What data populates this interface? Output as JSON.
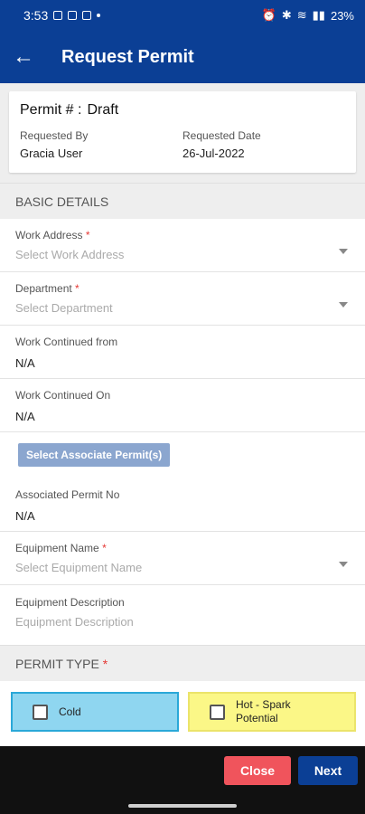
{
  "status_bar": {
    "time": "3:53",
    "battery": "23%"
  },
  "app_bar": {
    "title": "Request Permit"
  },
  "summary": {
    "permit_label": "Permit # :",
    "permit_value": "Draft",
    "requested_by_label": "Requested By",
    "requested_by_value": "Gracia User",
    "requested_date_label": "Requested Date",
    "requested_date_value": "26-Jul-2022"
  },
  "basic_details": {
    "header": "BASIC DETAILS",
    "work_address": {
      "label": "Work Address",
      "placeholder": "Select Work Address"
    },
    "department": {
      "label": "Department",
      "placeholder": "Select Department"
    },
    "work_continued_from": {
      "label": "Work Continued from",
      "value": "N/A"
    },
    "work_continued_on": {
      "label": "Work Continued On",
      "value": "N/A"
    },
    "select_associate_button": "Select Associate Permit(s)",
    "associated_permit_no": {
      "label": "Associated Permit No",
      "value": "N/A"
    },
    "equipment_name": {
      "label": "Equipment Name",
      "placeholder": "Select Equipment Name"
    },
    "equipment_description": {
      "label": "Equipment Description",
      "placeholder": "Equipment Description"
    }
  },
  "permit_type": {
    "header": "PERMIT TYPE",
    "options": [
      "Cold",
      "Hot - Spark Potential"
    ]
  },
  "required_mark": "*",
  "actions": {
    "close": "Close",
    "next": "Next"
  },
  "colors": {
    "primary": "#0b3f95",
    "close": "#f0545c",
    "cold": "#8fd6f0",
    "hot": "#fbf787"
  }
}
